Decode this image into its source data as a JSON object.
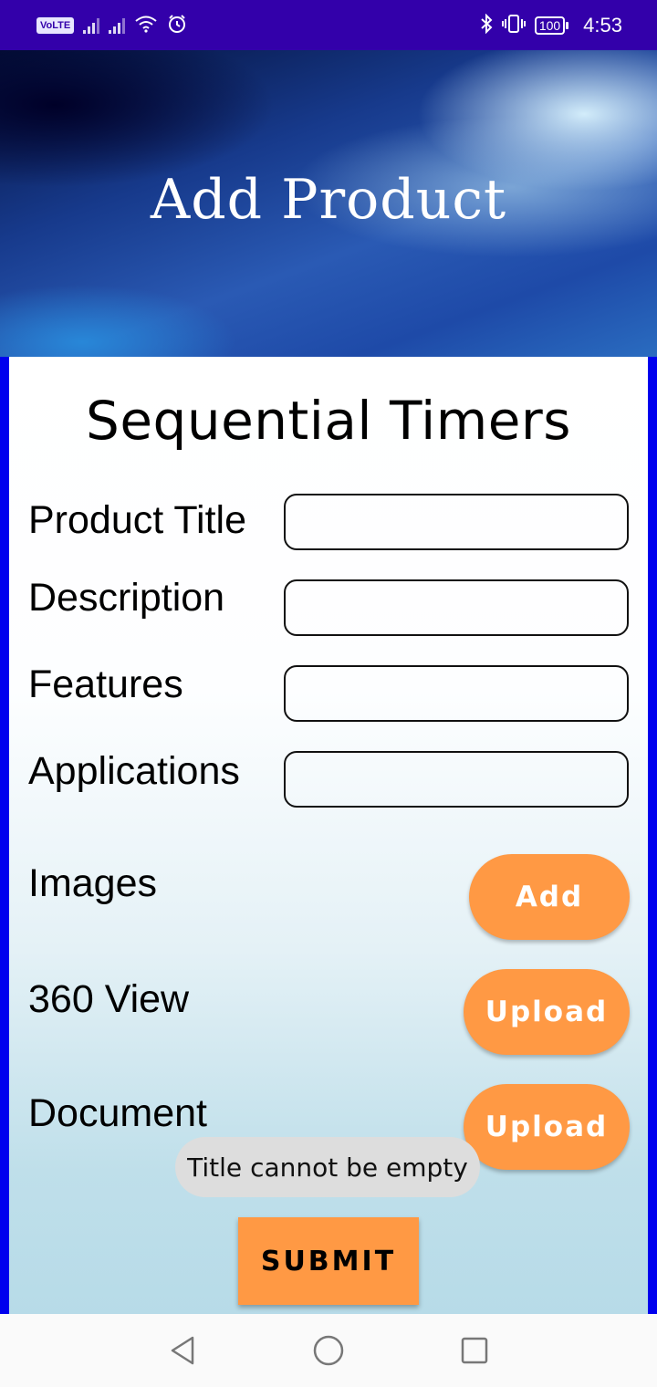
{
  "status_bar": {
    "network_badge": "VoLTE",
    "battery": "100",
    "time": "4:53",
    "icons": [
      "signal-icon",
      "signal-icon",
      "wifi-icon",
      "alarm-icon",
      "bluetooth-icon",
      "vibrate-icon",
      "battery-icon"
    ]
  },
  "header": {
    "title": "Add Product"
  },
  "form": {
    "title": "Sequential Timers",
    "fields": [
      {
        "label": "Product Title",
        "value": ""
      },
      {
        "label": "Description",
        "value": ""
      },
      {
        "label": "Features",
        "value": ""
      },
      {
        "label": "Applications",
        "value": ""
      }
    ],
    "images": {
      "label": "Images",
      "button": "Add"
    },
    "view360": {
      "label": "360 View",
      "button": "Upload"
    },
    "document": {
      "label": "Document",
      "button": "Upload"
    },
    "submit": "SUBMIT"
  },
  "toast": {
    "message": "Title cannot be empty"
  },
  "nav_bar": {
    "icons": [
      "back-icon",
      "home-icon",
      "recents-icon"
    ]
  },
  "colors": {
    "status_bar": "#3300aa",
    "accent_button": "#ff9944",
    "frame_border": "#0000ee",
    "toast_bg": "#dddddd"
  }
}
